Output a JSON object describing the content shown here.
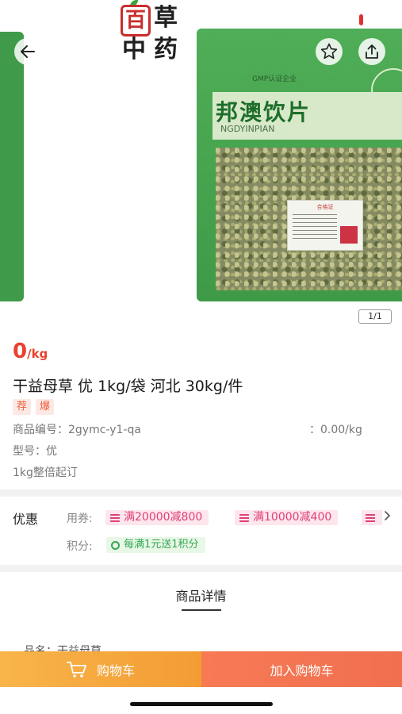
{
  "app": {
    "logo_text": [
      "百",
      "草",
      "中",
      "药"
    ]
  },
  "hero": {
    "brand_text": "邦澳饮片",
    "brand_sub": "NGDYINPIAN",
    "gmp_text": "GMP认证企业",
    "cert_title": "合格证",
    "pager": "1/1"
  },
  "product": {
    "price_value": "0",
    "price_unit": "/kg",
    "title": "干益母草 优 1kg/袋 河北 30kg/件",
    "tags": [
      "荐",
      "爆"
    ],
    "code_label": "商品编号：",
    "code_value": "2gymc-y1-qa",
    "unit_price_text": "：0.00/kg",
    "model_label": "型号：",
    "model_value": "优",
    "moq_text": "1kg整倍起订"
  },
  "promo": {
    "title": "优惠",
    "coupon_label": "用券:",
    "coupons": [
      "满20000减800",
      "满10000减400"
    ],
    "points_label": "积分:",
    "points_text": "每满1元送1积分"
  },
  "details": {
    "title": "商品详情",
    "peek_text": "品名：干益母草"
  },
  "bottom": {
    "cart_label": "购物车",
    "add_label": "加入购物车"
  },
  "colors": {
    "price": "#e8412f",
    "cart_button": "#f5a73d",
    "add_button": "#f2734f",
    "coupon": "#e0407a",
    "points": "#34a853"
  },
  "icons": [
    "back-arrow-icon",
    "star-icon",
    "share-icon",
    "cart-icon",
    "coupon-icon",
    "points-icon",
    "chevron-right-icon"
  ]
}
